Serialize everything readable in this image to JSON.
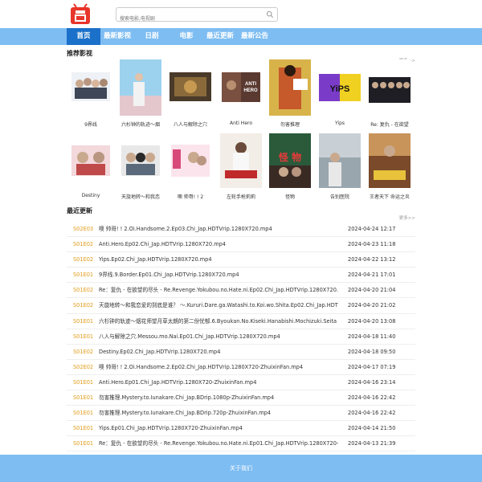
{
  "search": {
    "placeholder": "搜索电影,电视剧"
  },
  "nav": {
    "items": [
      "首页",
      "最新影视",
      "日剧",
      "电影",
      "最近更新",
      "最新公告"
    ],
    "active": 0
  },
  "recommend": {
    "title": "推荐影视",
    "more": "更多>>",
    "items": [
      {
        "caption": "9界线"
      },
      {
        "caption": "六杉钟的轨迹～烟"
      },
      {
        "caption": "八人与解除之穴"
      },
      {
        "caption": "Anti Hero",
        "poster_text": "ANTI HERO"
      },
      {
        "caption": "勿害推理"
      },
      {
        "caption": "Yips",
        "poster_text": "YiPS"
      },
      {
        "caption": "Re: 复仇 - 在欲望"
      },
      {
        "caption": "Destiny"
      },
      {
        "caption": "天旋地转～和我恋"
      },
      {
        "caption": "噢 帅哥! ! 2"
      },
      {
        "caption": "左轮手枪莉莉"
      },
      {
        "caption": "怪物",
        "poster_text": "怪 物"
      },
      {
        "caption": "告别医院"
      },
      {
        "caption": "王者天下 命运之炎"
      }
    ]
  },
  "recent": {
    "title": "最近更新",
    "more": "更多>>",
    "rows": [
      {
        "ep": "S02E03",
        "title": "噢 帅哥! ! 2.Oi.Handsome.2.Ep03.Chi_Jap.HDTVrip.1280X720.mp4",
        "date": "2024-04-24 12:17"
      },
      {
        "ep": "S01E02",
        "title": "Anti.Hero.Ep02.Chi_Jap.HDTVrip.1280X720.mp4",
        "date": "2024-04-23 11:18"
      },
      {
        "ep": "S01E02",
        "title": "Yips.Ep02.Chi_Jap.HDTVrip.1280X720.mp4",
        "date": "2024-04-22 13:12"
      },
      {
        "ep": "S01E01",
        "title": "9界线.9.Border.Ep01.Chi_Jap.HDTVrip.1280X720.mp4",
        "date": "2024-04-21 17:01"
      },
      {
        "ep": "S01E02",
        "title": "Re：复仇 - 在欲望的尽头 - Re.Revenge.Yokubou.no.Hate.ni.Ep02.Chi_Jap.HDTVrip.1280X720.",
        "date": "2024-04-20 21:04"
      },
      {
        "ep": "S01E02",
        "title": "天旋地转～和我恋爱的到底是谁？ ～.Kururi.Dare.ga.Watashi.to.Koi.wo.Shita.Ep02.Chi_Jap.HDT",
        "date": "2024-04-20 21:02"
      },
      {
        "ep": "S01E01",
        "title": "六杉钟的轨迹～烟花师望月草太朗的第二份忧郁.6.Byoukan.No.Kiseki.Hanabishi.Mochizuki.Seita",
        "date": "2024-04-20 13:08"
      },
      {
        "ep": "S01E01",
        "title": "八人与解除之穴.Messou.mo.Nai.Ep01.Chi_Jap.HDTVrip.1280X720.mp4",
        "date": "2024-04-18 11:40"
      },
      {
        "ep": "S01E02",
        "title": "Destiny.Ep02.Chi_Jap.HDTVrip.1280X720.mp4",
        "date": "2024-04-18 09:50"
      },
      {
        "ep": "S02E02",
        "title": "噢 帅哥! ! 2.Oi.Handsome.2.Ep02.Chi_Jap.HDTVrip.1280X720-ZhuixinFan.mp4",
        "date": "2024-04-17 07:19"
      },
      {
        "ep": "S01E01",
        "title": "Anti.Hero.Ep01.Chi_Jap.HDTVrip.1280X720-ZhuixinFan.mp4",
        "date": "2024-04-16 23:14"
      },
      {
        "ep": "S01E01",
        "title": "勿害推理.Mystery.to.Iunakare.Chi_Jap.BDrip.1080p-ZhuixinFan.mp4",
        "date": "2024-04-16 22:42"
      },
      {
        "ep": "S01E01",
        "title": "勿害推理.Mystery.to.Iunakare.Chi_Jap.BDrip.720p-ZhuixinFan.mp4",
        "date": "2024-04-16 22:42"
      },
      {
        "ep": "S01E01",
        "title": "Yips.Ep01.Chi_Jap.HDTVrip.1280X720-ZhuixinFan.mp4",
        "date": "2024-04-14 21:50"
      },
      {
        "ep": "S01E01",
        "title": "Re：复仇 - 在欲望的尽头 - Re.Revenge.Yokubou.no.Hate.ni.Ep01.Chi_Jap.HDTVrip.1280X720-",
        "date": "2024-04-13 21:39"
      }
    ]
  },
  "footer": {
    "label": "关于我们"
  },
  "colors": {
    "nav": "#7ebdf2",
    "nav_active": "#1b70c9",
    "episode": "#e09c18",
    "logo": "#e8352a"
  }
}
